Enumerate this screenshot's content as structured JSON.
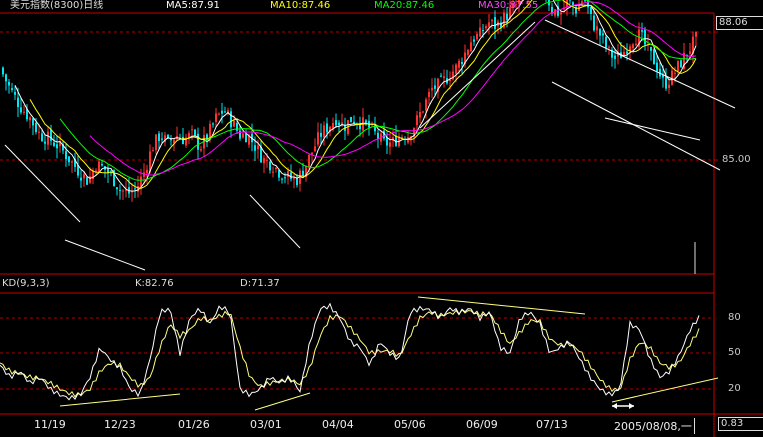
{
  "header": {
    "title": "美元指数(8300)日线",
    "ma5": "MA5:87.91",
    "ma10": "MA10:87.46",
    "ma20": "MA20:87.46",
    "ma30": "MA30:87.55"
  },
  "kd_panel": {
    "title": "KD(9,3,3)",
    "k": "K:82.76",
    "d": "D:71.37",
    "levels": [
      "80",
      "50",
      "20"
    ]
  },
  "price_axis": {
    "top_value": "88.06",
    "mid_value": "85.00"
  },
  "x_axis": {
    "dates": [
      "11/19",
      "12/23",
      "01/26",
      "03/01",
      "04/04",
      "05/06",
      "06/09",
      "07/13"
    ],
    "cursor_date": "2005/08/08,一"
  },
  "kd_value_box": "0.83",
  "colors": {
    "background": "#000000",
    "up_candle": "#ff3030",
    "down_candle": "#00e5ee",
    "ma5": "#ffffff",
    "ma10": "#ffff00",
    "ma20": "#00ff00",
    "ma30": "#ff00ff",
    "grid": "#b00000",
    "kd_k": "#ffffff",
    "kd_d": "#ffff80",
    "ma5_label": "#ffffff",
    "ma10_label": "#ffff00",
    "ma20_label": "#00ff00",
    "ma30_label": "#ff44ff"
  },
  "chart_data": {
    "type": "candlestick",
    "close_path": [
      [
        0,
        87.2
      ],
      [
        10,
        86.7
      ],
      [
        20,
        86.3
      ],
      [
        30,
        86.0
      ],
      [
        40,
        85.6
      ],
      [
        50,
        85.5
      ],
      [
        60,
        85.3
      ],
      [
        70,
        85.0
      ],
      [
        80,
        84.7
      ],
      [
        88,
        84.5
      ],
      [
        96,
        84.9
      ],
      [
        104,
        84.8
      ],
      [
        112,
        84.6
      ],
      [
        120,
        84.3
      ],
      [
        128,
        84.2
      ],
      [
        136,
        84.3
      ],
      [
        144,
        84.7
      ],
      [
        152,
        85.3
      ],
      [
        160,
        85.6
      ],
      [
        168,
        85.4
      ],
      [
        176,
        85.6
      ],
      [
        184,
        85.5
      ],
      [
        192,
        85.6
      ],
      [
        200,
        85.3
      ],
      [
        208,
        85.6
      ],
      [
        216,
        86.0
      ],
      [
        224,
        86.2
      ],
      [
        232,
        85.9
      ],
      [
        240,
        85.6
      ],
      [
        248,
        85.6
      ],
      [
        256,
        85.3
      ],
      [
        264,
        85.0
      ],
      [
        272,
        84.9
      ],
      [
        280,
        84.7
      ],
      [
        288,
        84.6
      ],
      [
        296,
        84.5
      ],
      [
        304,
        84.8
      ],
      [
        312,
        85.2
      ],
      [
        320,
        85.6
      ],
      [
        328,
        85.8
      ],
      [
        336,
        86.0
      ],
      [
        344,
        85.8
      ],
      [
        352,
        86.0
      ],
      [
        360,
        85.9
      ],
      [
        368,
        85.8
      ],
      [
        376,
        85.6
      ],
      [
        384,
        85.4
      ],
      [
        392,
        85.4
      ],
      [
        400,
        85.6
      ],
      [
        408,
        85.6
      ],
      [
        416,
        85.9
      ],
      [
        424,
        86.3
      ],
      [
        432,
        86.7
      ],
      [
        440,
        86.8
      ],
      [
        448,
        87.0
      ],
      [
        456,
        87.2
      ],
      [
        464,
        87.5
      ],
      [
        472,
        87.9
      ],
      [
        480,
        88.0
      ],
      [
        488,
        88.3
      ],
      [
        496,
        88.2
      ],
      [
        504,
        88.4
      ],
      [
        512,
        88.6
      ],
      [
        520,
        88.8
      ],
      [
        528,
        89.0
      ],
      [
        536,
        89.2
      ],
      [
        544,
        89.1
      ],
      [
        552,
        88.6
      ],
      [
        560,
        88.5
      ],
      [
        568,
        88.8
      ],
      [
        576,
        88.6
      ],
      [
        584,
        88.9
      ],
      [
        592,
        88.3
      ],
      [
        600,
        88.0
      ],
      [
        608,
        87.6
      ],
      [
        616,
        87.4
      ],
      [
        624,
        87.6
      ],
      [
        632,
        87.9
      ],
      [
        640,
        88.0
      ],
      [
        648,
        87.6
      ],
      [
        656,
        87.3
      ],
      [
        664,
        86.8
      ],
      [
        672,
        87.0
      ],
      [
        680,
        87.3
      ],
      [
        688,
        87.6
      ],
      [
        696,
        87.9
      ]
    ],
    "kd_k": [
      [
        0,
        40
      ],
      [
        10,
        30
      ],
      [
        20,
        35
      ],
      [
        30,
        25
      ],
      [
        40,
        30
      ],
      [
        50,
        20
      ],
      [
        60,
        15
      ],
      [
        70,
        12
      ],
      [
        80,
        15
      ],
      [
        90,
        30
      ],
      [
        100,
        55
      ],
      [
        110,
        45
      ],
      [
        120,
        38
      ],
      [
        130,
        20
      ],
      [
        140,
        15
      ],
      [
        150,
        45
      ],
      [
        160,
        85
      ],
      [
        170,
        88
      ],
      [
        180,
        50
      ],
      [
        190,
        80
      ],
      [
        200,
        88
      ],
      [
        210,
        75
      ],
      [
        220,
        90
      ],
      [
        230,
        85
      ],
      [
        240,
        20
      ],
      [
        250,
        15
      ],
      [
        260,
        20
      ],
      [
        270,
        30
      ],
      [
        280,
        25
      ],
      [
        290,
        30
      ],
      [
        300,
        18
      ],
      [
        310,
        60
      ],
      [
        320,
        88
      ],
      [
        330,
        90
      ],
      [
        340,
        80
      ],
      [
        350,
        60
      ],
      [
        360,
        55
      ],
      [
        370,
        40
      ],
      [
        380,
        60
      ],
      [
        390,
        50
      ],
      [
        400,
        45
      ],
      [
        410,
        85
      ],
      [
        420,
        88
      ],
      [
        430,
        87
      ],
      [
        440,
        80
      ],
      [
        450,
        88
      ],
      [
        460,
        85
      ],
      [
        470,
        88
      ],
      [
        480,
        80
      ],
      [
        490,
        85
      ],
      [
        500,
        55
      ],
      [
        510,
        50
      ],
      [
        520,
        80
      ],
      [
        530,
        85
      ],
      [
        540,
        75
      ],
      [
        550,
        50
      ],
      [
        560,
        55
      ],
      [
        570,
        60
      ],
      [
        580,
        45
      ],
      [
        590,
        30
      ],
      [
        600,
        20
      ],
      [
        610,
        15
      ],
      [
        620,
        20
      ],
      [
        630,
        75
      ],
      [
        640,
        70
      ],
      [
        650,
        45
      ],
      [
        660,
        30
      ],
      [
        670,
        35
      ],
      [
        680,
        50
      ],
      [
        690,
        70
      ],
      [
        700,
        82
      ]
    ],
    "kd_d": [
      [
        0,
        42
      ],
      [
        10,
        35
      ],
      [
        20,
        33
      ],
      [
        30,
        30
      ],
      [
        40,
        29
      ],
      [
        50,
        25
      ],
      [
        60,
        20
      ],
      [
        70,
        16
      ],
      [
        80,
        15
      ],
      [
        90,
        20
      ],
      [
        100,
        35
      ],
      [
        110,
        42
      ],
      [
        120,
        40
      ],
      [
        130,
        30
      ],
      [
        140,
        22
      ],
      [
        150,
        30
      ],
      [
        160,
        55
      ],
      [
        170,
        75
      ],
      [
        180,
        65
      ],
      [
        190,
        70
      ],
      [
        200,
        80
      ],
      [
        210,
        78
      ],
      [
        220,
        82
      ],
      [
        230,
        85
      ],
      [
        240,
        55
      ],
      [
        250,
        30
      ],
      [
        260,
        22
      ],
      [
        270,
        25
      ],
      [
        280,
        27
      ],
      [
        290,
        28
      ],
      [
        300,
        24
      ],
      [
        310,
        38
      ],
      [
        320,
        65
      ],
      [
        330,
        80
      ],
      [
        340,
        82
      ],
      [
        350,
        72
      ],
      [
        360,
        62
      ],
      [
        370,
        50
      ],
      [
        380,
        52
      ],
      [
        390,
        52
      ],
      [
        400,
        48
      ],
      [
        410,
        65
      ],
      [
        420,
        80
      ],
      [
        430,
        85
      ],
      [
        440,
        82
      ],
      [
        450,
        84
      ],
      [
        460,
        85
      ],
      [
        470,
        86
      ],
      [
        480,
        83
      ],
      [
        490,
        84
      ],
      [
        500,
        70
      ],
      [
        510,
        58
      ],
      [
        520,
        68
      ],
      [
        530,
        78
      ],
      [
        540,
        77
      ],
      [
        550,
        62
      ],
      [
        560,
        57
      ],
      [
        570,
        58
      ],
      [
        580,
        52
      ],
      [
        590,
        40
      ],
      [
        600,
        28
      ],
      [
        610,
        20
      ],
      [
        620,
        19
      ],
      [
        630,
        45
      ],
      [
        640,
        60
      ],
      [
        650,
        55
      ],
      [
        660,
        42
      ],
      [
        670,
        38
      ],
      [
        680,
        43
      ],
      [
        690,
        58
      ],
      [
        700,
        71
      ]
    ]
  }
}
